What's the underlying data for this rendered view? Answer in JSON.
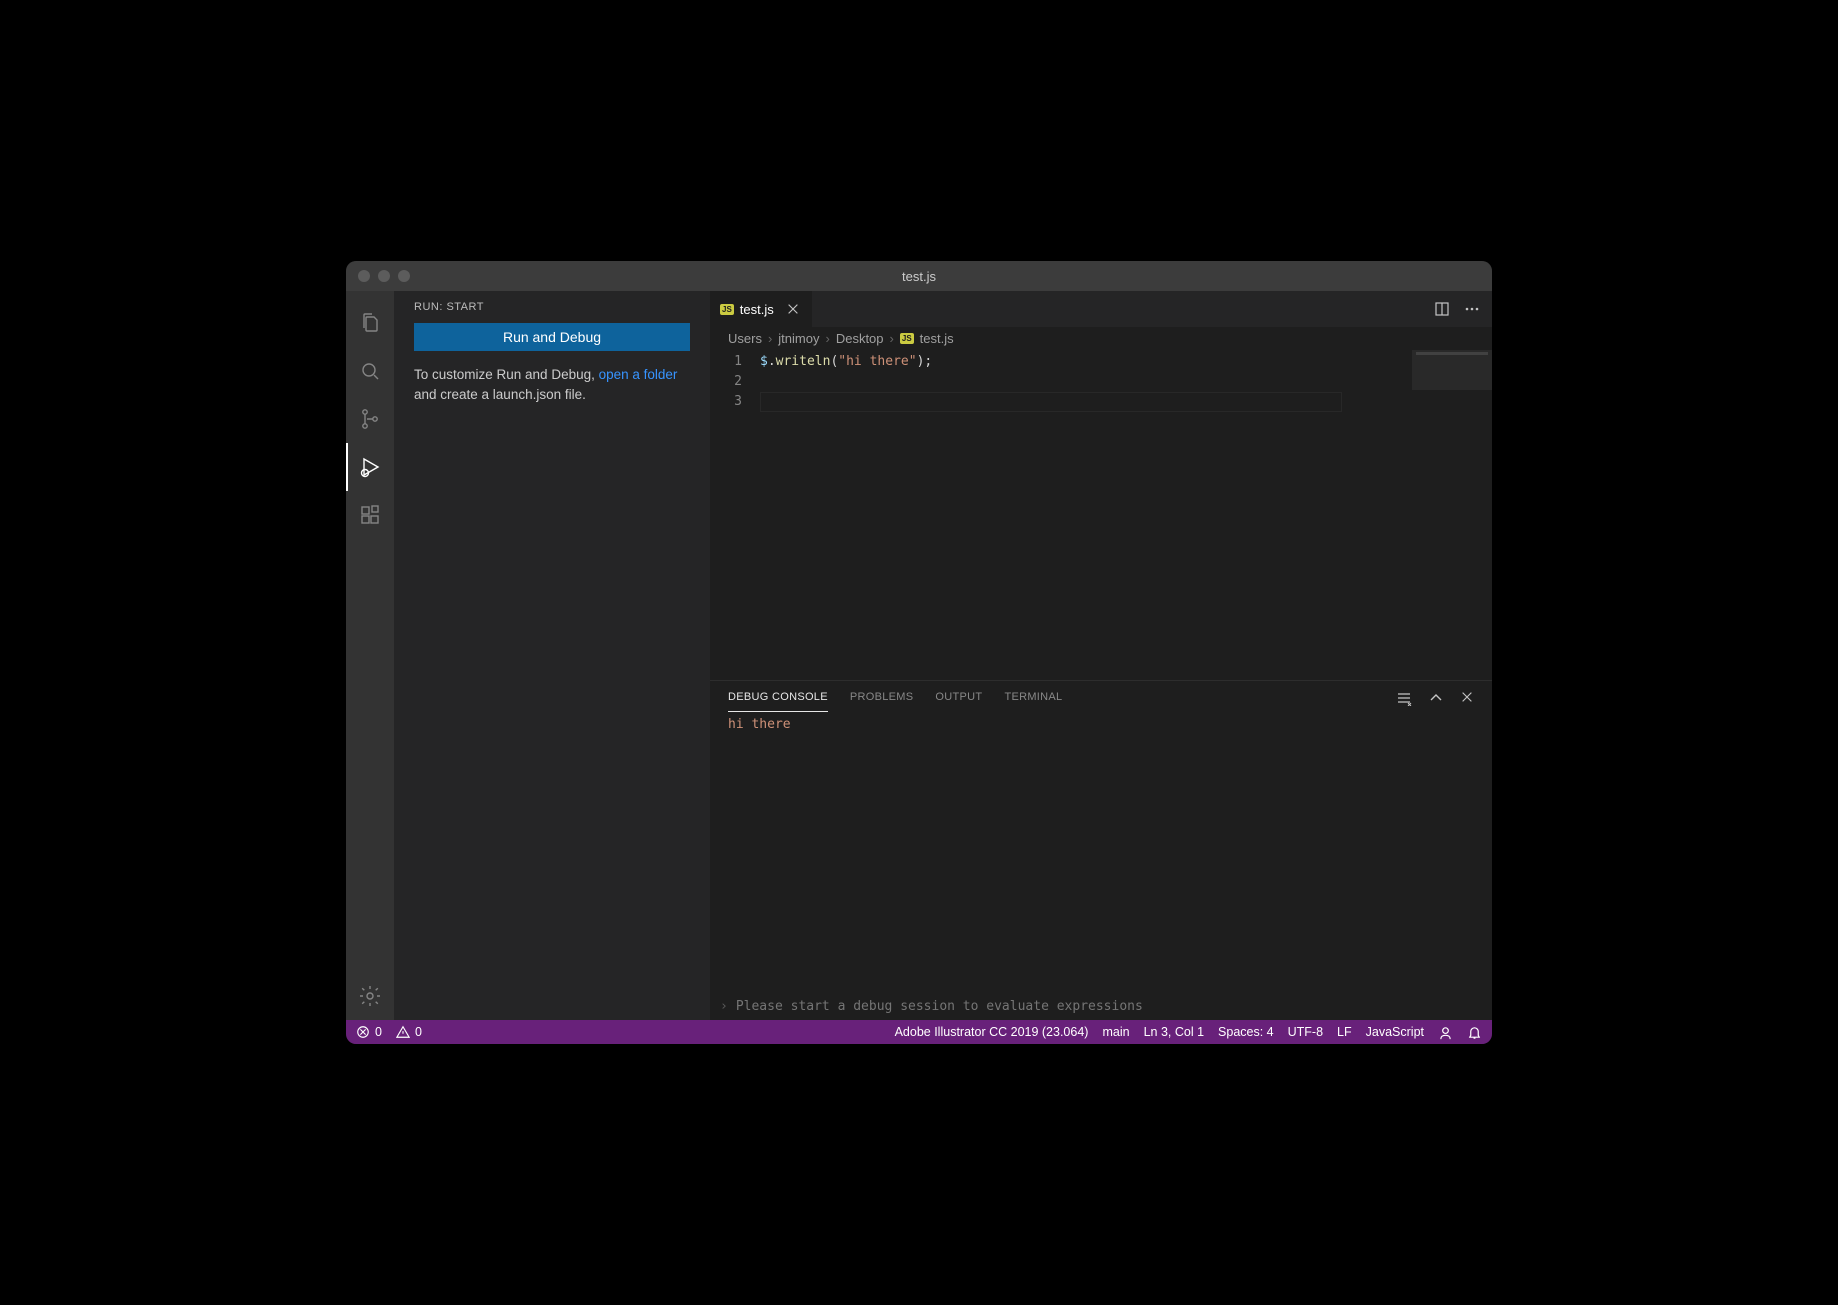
{
  "titlebar": {
    "title": "test.js"
  },
  "sidebar": {
    "header": "RUN: START",
    "run_button": "Run and Debug",
    "desc_prefix": "To customize Run and Debug, ",
    "desc_link": "open a folder",
    "desc_suffix": " and create a launch.json file."
  },
  "tabs": {
    "active": {
      "label": "test.js",
      "icon_text": "JS"
    }
  },
  "breadcrumb": {
    "parts": [
      "Users",
      "jtnimoy",
      "Desktop",
      "test.js"
    ],
    "icon_text": "JS"
  },
  "editor": {
    "lines": [
      "1",
      "2",
      "3"
    ],
    "code_var": "$",
    "code_dot": ".",
    "code_fn": "writeln",
    "code_open": "(",
    "code_str": "\"hi there\"",
    "code_close": ");"
  },
  "panel": {
    "tabs": [
      "DEBUG CONSOLE",
      "PROBLEMS",
      "OUTPUT",
      "TERMINAL"
    ],
    "output": "hi there",
    "input_placeholder": "Please start a debug session to evaluate expressions"
  },
  "statusbar": {
    "errors": "0",
    "warnings": "0",
    "host": "Adobe Illustrator CC 2019 (23.064)",
    "branch": "main",
    "cursor": "Ln 3, Col 1",
    "spaces": "Spaces: 4",
    "encoding": "UTF-8",
    "eol": "LF",
    "language": "JavaScript"
  }
}
